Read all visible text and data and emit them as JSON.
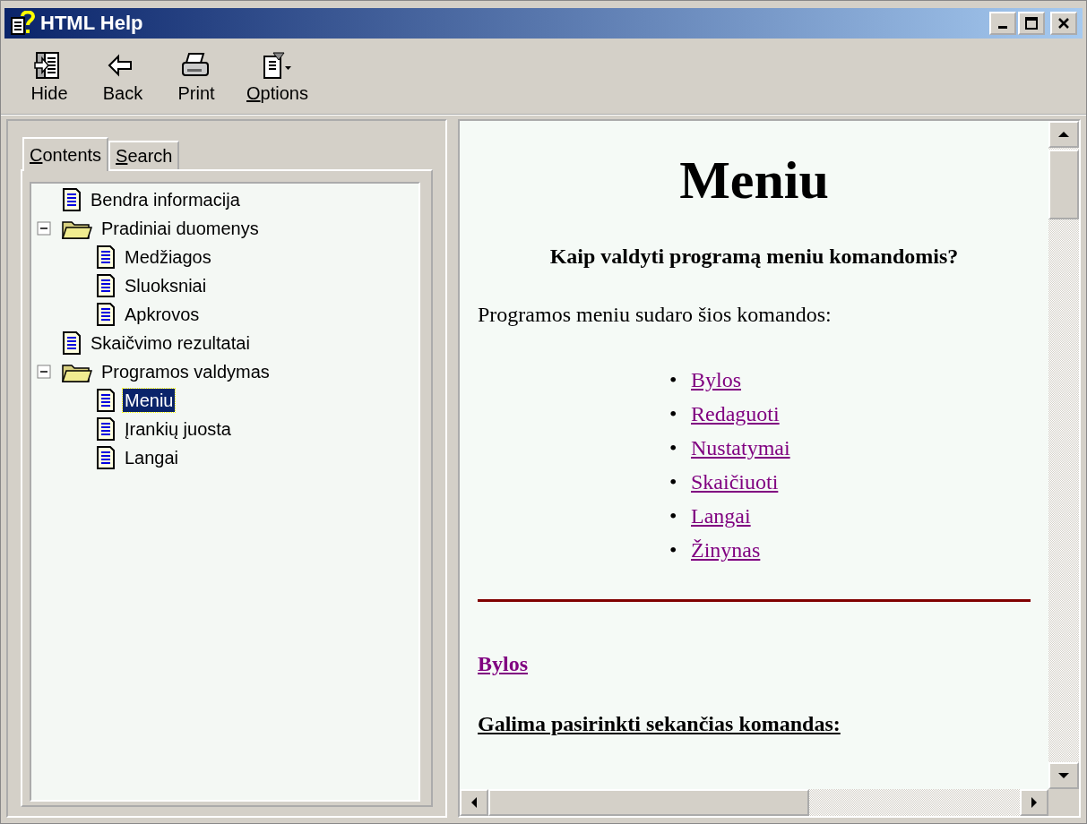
{
  "window": {
    "title": "HTML Help"
  },
  "toolbar": [
    {
      "kind": "hide",
      "label": "Hide",
      "mnemonic": false
    },
    {
      "kind": "back",
      "label": "Back",
      "mnemonic": false
    },
    {
      "kind": "print",
      "label": "Print",
      "mnemonic": false
    },
    {
      "kind": "options",
      "label": "Options",
      "mnemonic": true
    }
  ],
  "tabs": [
    {
      "label": "Contents",
      "selected": true,
      "mnemonic": true
    },
    {
      "label": "Search",
      "selected": false,
      "mnemonic": true
    }
  ],
  "tree": [
    {
      "kind": "page",
      "label": "Bendra informacija",
      "selected": false
    },
    {
      "kind": "folder",
      "label": "Pradiniai duomenys",
      "selected": false,
      "expanded": true,
      "children": [
        {
          "kind": "page",
          "label": "Medžiagos",
          "selected": false
        },
        {
          "kind": "page",
          "label": "Sluoksniai",
          "selected": false
        },
        {
          "kind": "page",
          "label": "Apkrovos",
          "selected": false
        }
      ]
    },
    {
      "kind": "page",
      "label": "Skaičvimo rezultatai",
      "selected": false
    },
    {
      "kind": "folder",
      "label": "Programos valdymas",
      "selected": false,
      "expanded": true,
      "children": [
        {
          "kind": "page",
          "label": "Meniu",
          "selected": true
        },
        {
          "kind": "page",
          "label": "Įrankių juosta",
          "selected": false
        },
        {
          "kind": "page",
          "label": "Langai",
          "selected": false
        }
      ]
    }
  ],
  "topic": {
    "title": "Meniu",
    "subtitle": "Kaip valdyti programą meniu komandomis?",
    "intro": "Programos meniu sudaro šios komandos:",
    "links": [
      {
        "bullet": "•",
        "label": "Bylos"
      },
      {
        "bullet": "•",
        "label": "Redaguoti"
      },
      {
        "bullet": "•",
        "label": "Nustatymai"
      },
      {
        "bullet": "•",
        "label": "Skaičiuoti"
      },
      {
        "bullet": "•",
        "label": "Langai"
      },
      {
        "bullet": "•",
        "label": "Žinynas"
      }
    ],
    "section_heading": "Bylos",
    "section_subheading": "Galima pasirinkti sekančias komandas:"
  }
}
